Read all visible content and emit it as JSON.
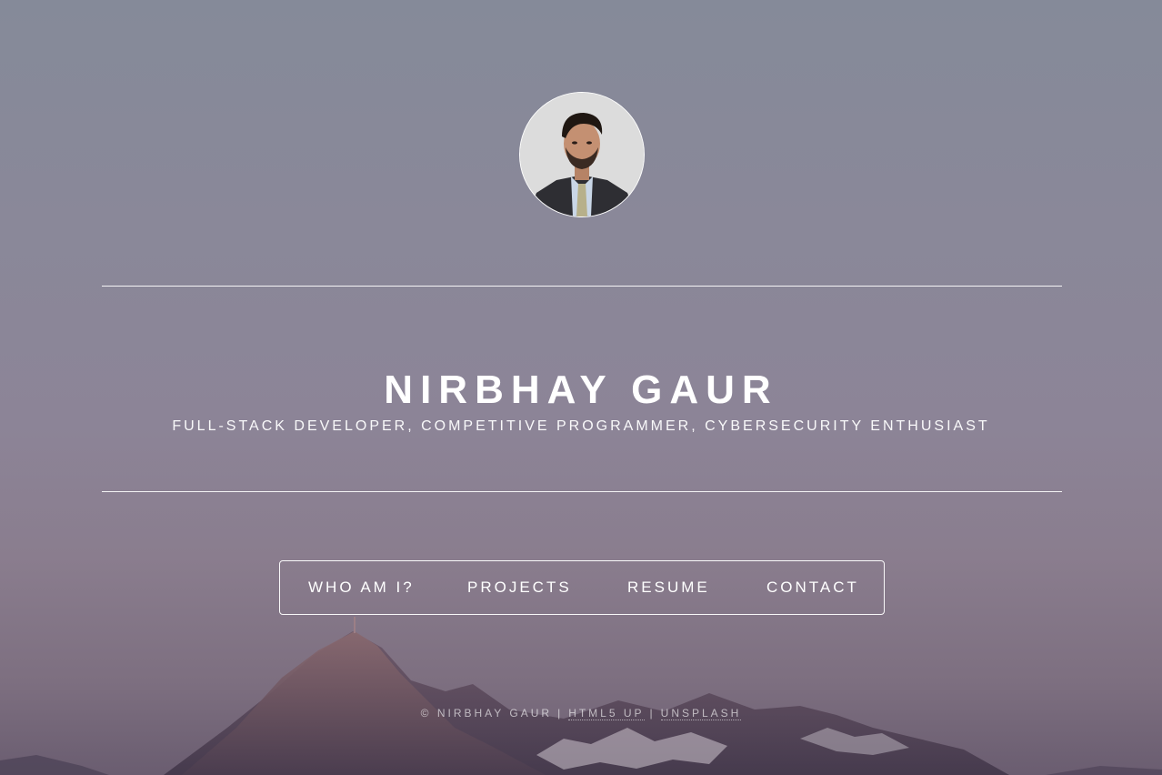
{
  "profile": {
    "name": "Nirbhay Gaur",
    "tagline": "Full-Stack Developer, Competitive Programmer, Cybersecurity Enthusiast"
  },
  "nav": {
    "items": [
      {
        "label": "Who am I?"
      },
      {
        "label": "Projects"
      },
      {
        "label": "Resume"
      },
      {
        "label": "Contact"
      }
    ]
  },
  "footer": {
    "copyright": "© Nirbhay Gaur",
    "separator": "|",
    "link_html5up": "HTML5 UP",
    "link_unsplash": "Unsplash"
  },
  "colors": {
    "text": "#ffffff",
    "background_top": "#858a99",
    "background_bottom": "#6a5d70"
  }
}
